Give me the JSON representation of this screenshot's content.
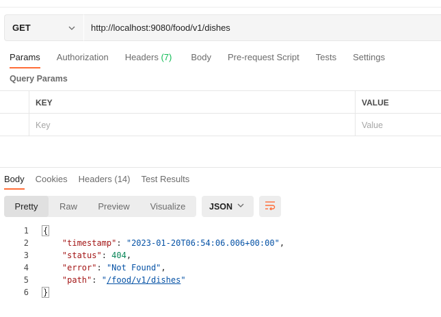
{
  "request": {
    "method": "GET",
    "url": "http://localhost:9080/food/v1/dishes"
  },
  "request_tabs": [
    {
      "label": "Params",
      "active": true
    },
    {
      "label": "Authorization"
    },
    {
      "label": "Headers",
      "count": "(7)"
    },
    {
      "label": "Body"
    },
    {
      "label": "Pre-request Script"
    },
    {
      "label": "Tests"
    },
    {
      "label": "Settings"
    }
  ],
  "query_params": {
    "title": "Query Params",
    "columns": {
      "key": "KEY",
      "value": "VALUE"
    },
    "placeholders": {
      "key": "Key",
      "value": "Value"
    }
  },
  "response_tabs": [
    {
      "label": "Body",
      "active": true
    },
    {
      "label": "Cookies"
    },
    {
      "label": "Headers (14)"
    },
    {
      "label": "Test Results"
    }
  ],
  "format_toolbar": {
    "modes": [
      "Pretty",
      "Raw",
      "Preview",
      "Visualize"
    ],
    "active_mode": "Pretty",
    "language": "JSON",
    "wrap_icon": "wrap-lines-icon"
  },
  "response_body": {
    "line_numbers": [
      "1",
      "2",
      "3",
      "4",
      "5",
      "6"
    ],
    "open_brace": "{",
    "close_brace": "}",
    "fields": [
      {
        "key": "\"timestamp\"",
        "value": "\"2023-01-20T06:54:06.006+00:00\""
      },
      {
        "key": "\"status\"",
        "value": "404"
      },
      {
        "key": "\"error\"",
        "value": "\"Not Found\""
      },
      {
        "key": "\"path\"",
        "value": "/food/v1/dishes"
      }
    ]
  },
  "colors": {
    "accent": "#ff6c37",
    "count_green": "#0cbb52",
    "json_key": "#a31515",
    "json_string": "#0451a5",
    "json_number": "#098658"
  }
}
